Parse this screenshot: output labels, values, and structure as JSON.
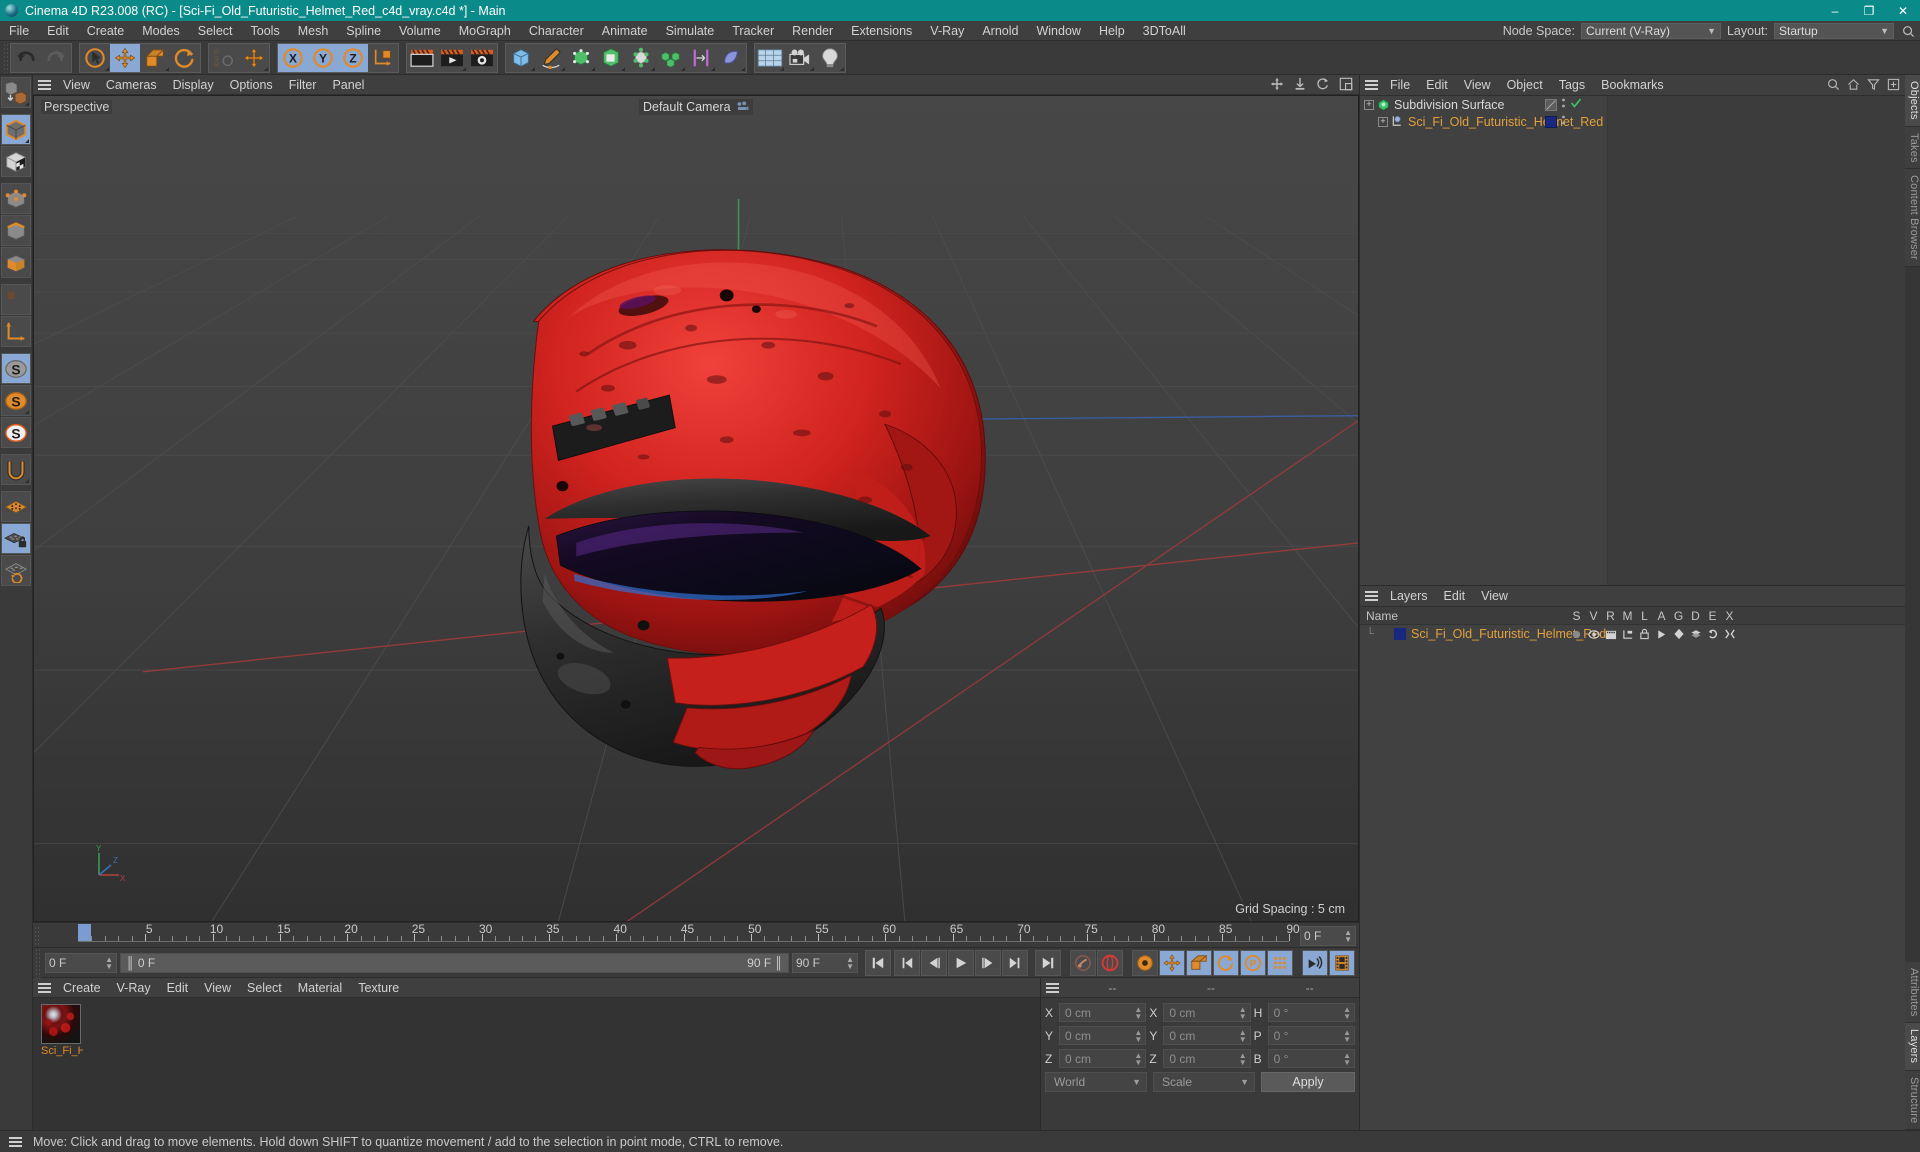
{
  "titlebar": {
    "title": "Cinema 4D R23.008 (RC) - [Sci-Fi_Old_Futuristic_Helmet_Red_c4d_vray.c4d *] - Main",
    "minimize": "–",
    "maximize": "❐",
    "close": "✕"
  },
  "menubar": {
    "items": [
      {
        "label": "File"
      },
      {
        "label": "Edit"
      },
      {
        "label": "Create"
      },
      {
        "label": "Modes"
      },
      {
        "label": "Select"
      },
      {
        "label": "Tools"
      },
      {
        "label": "Mesh"
      },
      {
        "label": "Spline"
      },
      {
        "label": "Volume"
      },
      {
        "label": "MoGraph"
      },
      {
        "label": "Character"
      },
      {
        "label": "Animate"
      },
      {
        "label": "Simulate"
      },
      {
        "label": "Tracker"
      },
      {
        "label": "Render"
      },
      {
        "label": "Extensions"
      },
      {
        "label": "V-Ray"
      },
      {
        "label": "Arnold"
      },
      {
        "label": "Window"
      },
      {
        "label": "Help"
      },
      {
        "label": "3DToAll"
      }
    ],
    "node_space_label": "Node Space:",
    "node_space_value": "Current (V-Ray)",
    "layout_label": "Layout:",
    "layout_value": "Startup"
  },
  "viewport": {
    "menu": [
      {
        "label": "View"
      },
      {
        "label": "Cameras"
      },
      {
        "label": "Display"
      },
      {
        "label": "Options"
      },
      {
        "label": "Filter"
      },
      {
        "label": "Panel"
      }
    ],
    "projection_label": "Perspective",
    "camera_label": "Default Camera",
    "grid_spacing": "Grid Spacing : 5 cm",
    "axis_x": "X",
    "axis_y": "Y",
    "axis_z": "Z"
  },
  "timeline": {
    "ticks": [
      0,
      5,
      10,
      15,
      20,
      25,
      30,
      35,
      40,
      45,
      50,
      55,
      60,
      65,
      70,
      75,
      80,
      85,
      90
    ],
    "min_frame": 0,
    "max_frame": 90,
    "current_frame_field": "0 F",
    "preview_start": "0 F",
    "preview_end": "90 F",
    "range_start": "0 F",
    "range_end": "90 F",
    "right_frame_field": "0 F"
  },
  "material_manager": {
    "menu": [
      {
        "label": "Create"
      },
      {
        "label": "V-Ray"
      },
      {
        "label": "Edit"
      },
      {
        "label": "View"
      },
      {
        "label": "Select"
      },
      {
        "label": "Material"
      },
      {
        "label": "Texture"
      }
    ],
    "materials": [
      {
        "name": "Sci_Fi_He"
      }
    ]
  },
  "coordinates": {
    "headers": [
      "--",
      "--",
      "--"
    ],
    "rows": [
      {
        "label1": "X",
        "value1": "0 cm",
        "label2": "X",
        "value2": "0 cm",
        "label3": "H",
        "value3": "0 °"
      },
      {
        "label1": "Y",
        "value1": "0 cm",
        "label2": "Y",
        "value2": "0 cm",
        "label3": "P",
        "value3": "0 °"
      },
      {
        "label1": "Z",
        "value1": "0 cm",
        "label2": "Z",
        "value2": "0 cm",
        "label3": "B",
        "value3": "0 °"
      }
    ],
    "system": "World",
    "mode": "Scale",
    "apply": "Apply"
  },
  "object_manager": {
    "menu": [
      {
        "label": "File"
      },
      {
        "label": "Edit"
      },
      {
        "label": "View"
      },
      {
        "label": "Object"
      },
      {
        "label": "Tags"
      },
      {
        "label": "Bookmarks"
      }
    ],
    "rows": [
      {
        "name": "Subdivision Surface",
        "depth": 0
      },
      {
        "name": "Sci_Fi_Old_Futuristic_Helmet_Red",
        "depth": 1
      }
    ]
  },
  "layer_manager": {
    "menu": [
      {
        "label": "Layers"
      },
      {
        "label": "Edit"
      },
      {
        "label": "View"
      }
    ],
    "name_header": "Name",
    "columns": [
      "S",
      "V",
      "R",
      "M",
      "L",
      "A",
      "G",
      "D",
      "E",
      "X"
    ],
    "rows": [
      {
        "name": "Sci_Fi_Old_Futuristic_Helmet_Red",
        "color": "#18277f"
      }
    ]
  },
  "vertical_tabs_top": [
    {
      "label": "Objects",
      "active": true
    },
    {
      "label": "Takes",
      "active": false
    },
    {
      "label": "Content Browser",
      "active": false
    }
  ],
  "vertical_tabs_bottom": [
    {
      "label": "Attributes",
      "active": false
    },
    {
      "label": "Layers",
      "active": true
    },
    {
      "label": "Structure",
      "active": false
    }
  ],
  "statusbar": {
    "message": "Move: Click and drag to move elements. Hold down SHIFT to quantize movement / add to the selection in point mode, CTRL to remove."
  },
  "colors": {
    "title_bar": "#0b8a8a",
    "accent_orange": "#e2a13c",
    "selected_blue": "#8aa8d4",
    "layer_swatch": "#18277f",
    "panel_bg": "#3a3a3a",
    "viewport_bg": "#414141",
    "helmet_red": "#d1231f"
  }
}
